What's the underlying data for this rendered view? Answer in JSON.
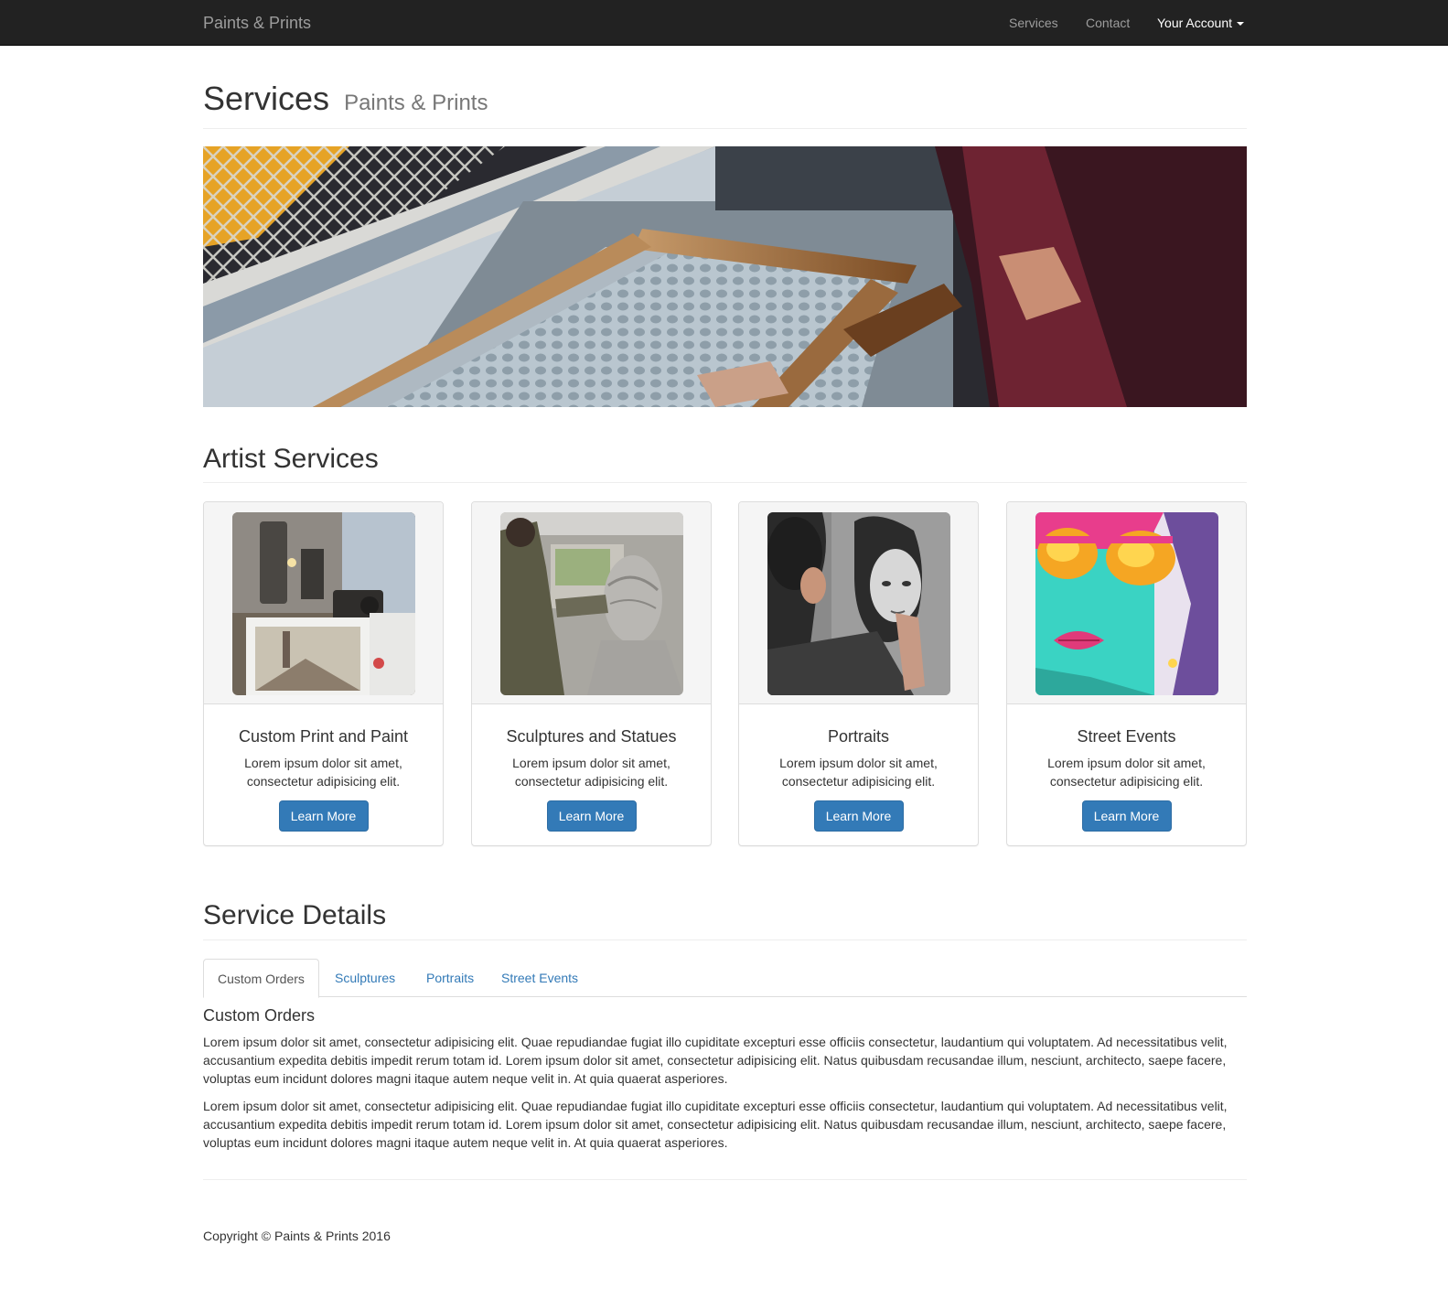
{
  "navbar": {
    "brand": "Paints & Prints",
    "links": [
      {
        "label": "Services"
      },
      {
        "label": "Contact"
      },
      {
        "label": "Your Account"
      }
    ]
  },
  "header": {
    "title": "Services",
    "subtitle": "Paints & Prints"
  },
  "sections": {
    "artist_services": "Artist Services",
    "service_details": "Service Details"
  },
  "cards": [
    {
      "title": "Custom Print and Paint",
      "text": "Lorem ipsum dolor sit amet, consectetur adipisicing elit.",
      "button": "Learn More"
    },
    {
      "title": "Sculptures and Statues",
      "text": "Lorem ipsum dolor sit amet, consectetur adipisicing elit.",
      "button": "Learn More"
    },
    {
      "title": "Portraits",
      "text": "Lorem ipsum dolor sit amet, consectetur adipisicing elit.",
      "button": "Learn More"
    },
    {
      "title": "Street Events",
      "text": "Lorem ipsum dolor sit amet, consectetur adipisicing elit.",
      "button": "Learn More"
    }
  ],
  "tabs": [
    {
      "label": "Custom Orders",
      "active": true
    },
    {
      "label": "Sculptures"
    },
    {
      "label": "Portraits"
    },
    {
      "label": "Street Events"
    }
  ],
  "tab_content": {
    "heading": "Custom Orders",
    "paragraphs": [
      "Lorem ipsum dolor sit amet, consectetur adipisicing elit. Quae repudiandae fugiat illo cupiditate excepturi esse officiis consectetur, laudantium qui voluptatem. Ad necessitatibus velit, accusantium expedita debitis impedit rerum totam id. Lorem ipsum dolor sit amet, consectetur adipisicing elit. Natus quibusdam recusandae illum, nesciunt, architecto, saepe facere, voluptas eum incidunt dolores magni itaque autem neque velit in. At quia quaerat asperiores.",
      "Lorem ipsum dolor sit amet, consectetur adipisicing elit. Quae repudiandae fugiat illo cupiditate excepturi esse officiis consectetur, laudantium qui voluptatem. Ad necessitatibus velit, accusantium expedita debitis impedit rerum totam id. Lorem ipsum dolor sit amet, consectetur adipisicing elit. Natus quibusdam recusandae illum, nesciunt, architecto, saepe facere, voluptas eum incidunt dolores magni itaque autem neque velit in. At quia quaerat asperiores."
    ]
  },
  "footer": {
    "copyright": "Copyright © Paints & Prints 2016"
  },
  "colors": {
    "navbar_bg": "#222222",
    "primary": "#337ab7",
    "link": "#337ab7"
  }
}
